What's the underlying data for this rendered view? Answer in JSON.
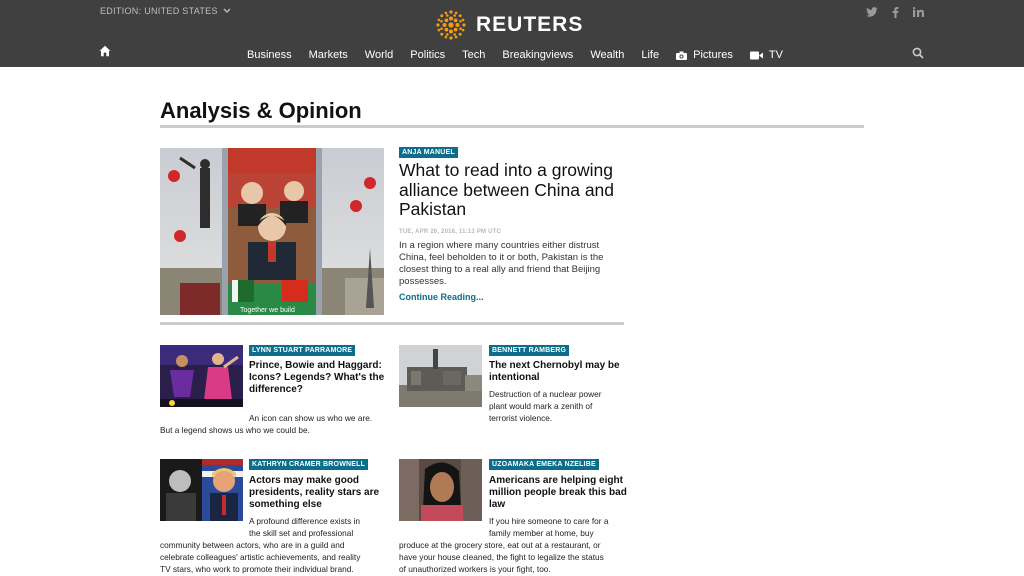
{
  "header": {
    "edition_label": "EDITION: UNITED STATES",
    "brand": "REUTERS",
    "social": [
      "twitter-icon",
      "facebook-icon",
      "linkedin-icon"
    ],
    "nav": [
      {
        "label": "Business"
      },
      {
        "label": "Markets"
      },
      {
        "label": "World"
      },
      {
        "label": "Politics"
      },
      {
        "label": "Tech"
      },
      {
        "label": "Breakingviews"
      },
      {
        "label": "Wealth"
      },
      {
        "label": "Life"
      },
      {
        "label": "Pictures",
        "icon": "camera-icon"
      },
      {
        "label": "TV",
        "icon": "video-icon"
      }
    ]
  },
  "page": {
    "title": "Analysis & Opinion"
  },
  "hero": {
    "author": "ANJA MANUEL",
    "headline": "What to read into a growing alliance between China and Pakistan",
    "date": "TUE, APR 26, 2016, 11:13 PM UTC",
    "summary": "In a region where many countries either distrust China, feel beholden to it or both, Pakistan is the closest thing to a real ally and friend that Beijing possesses.",
    "link": "Continue Reading...",
    "image_caption": "Together we build"
  },
  "cards": [
    {
      "author": "LYNN STUART PARRAMORE",
      "headline": "Prince, Bowie and Haggard: Icons? Legends? What's the difference?",
      "summary_lines": [
        "An icon can show us who we are.",
        "But a legend shows us who we could be."
      ]
    },
    {
      "author": "BENNETT RAMBERG",
      "headline": "The next Chernobyl may be intentional",
      "summary_lines": [
        "Destruction of a nuclear power",
        "plant would mark a zenith of",
        "terrorist violence."
      ]
    },
    {
      "author": "KATHRYN CRAMER BROWNELL",
      "headline": "Actors may make good presidents, reality stars are something else",
      "summary_lines": [
        "A profound difference exists in",
        "the skill set and professional",
        "community between actors, who are in a guild and",
        "celebrate colleagues' artistic achievements, and reality",
        "TV stars, who work to promote their individual brand."
      ]
    },
    {
      "author": "UZOAMAKA EMEKA NZELIBE",
      "headline": "Americans are helping eight million people break this bad law",
      "summary_lines": [
        "If you hire someone to care for a",
        "family member at home, buy",
        "produce at the grocery store, eat out at a restaurant, or",
        "have your house cleaned, the fight to legalize the status",
        "of unauthorized workers is your fight, too."
      ]
    }
  ],
  "colors": {
    "header_bg": "#404040",
    "brand_orange": "#f39c12",
    "tag_bg": "#0d6e8c",
    "link": "#0d6e8c"
  }
}
